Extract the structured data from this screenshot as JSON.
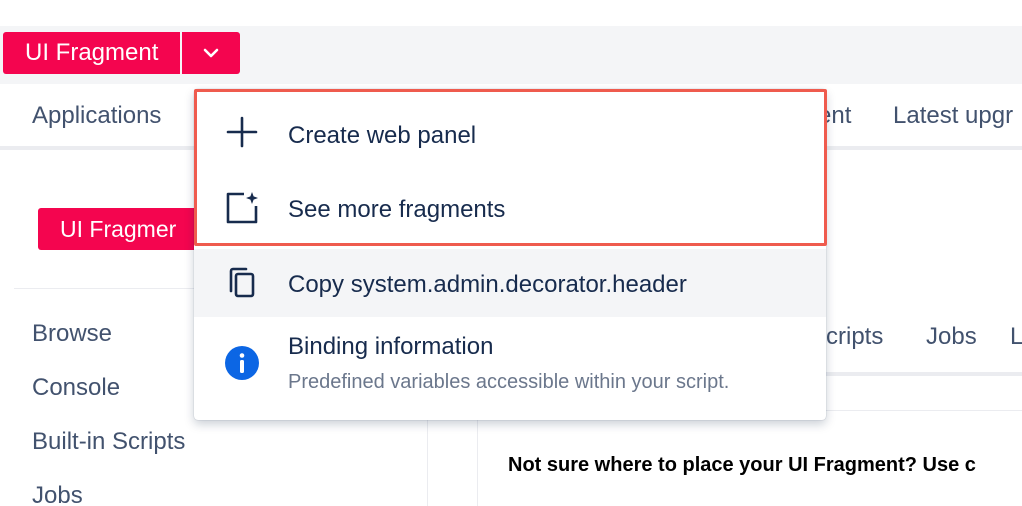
{
  "header": {
    "split_button_label": "UI Fragment",
    "dropdown_icon": "chevron-down-icon",
    "brand_color": "#f4054f"
  },
  "nav": {
    "items": [
      "Applications",
      "ent",
      "Latest upgr"
    ]
  },
  "sidebar": {
    "badge_label": "UI Fragmer",
    "links": [
      "Browse",
      "Console",
      "Built-in Scripts",
      "Jobs"
    ]
  },
  "content": {
    "tabs": [
      "cripts",
      "Jobs",
      "L"
    ],
    "notice": "Not sure where to place your UI Fragment? Use c"
  },
  "dropdown": {
    "items": [
      {
        "label": "Create web panel",
        "icon": "plus-icon"
      },
      {
        "label": "See more fragments",
        "icon": "add-fragment-icon"
      },
      {
        "label": "Copy system.admin.decorator.header",
        "icon": "copy-icon"
      },
      {
        "label": "Binding information",
        "description": "Predefined variables accessible within your script.",
        "icon": "info-icon"
      }
    ],
    "highlight_color": "#ef5b4e"
  }
}
